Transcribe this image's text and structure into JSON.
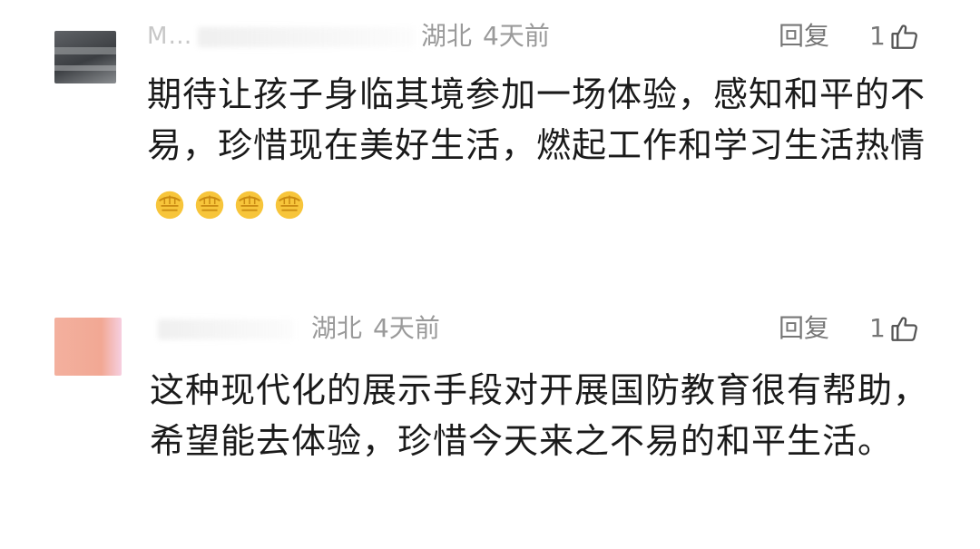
{
  "comments": [
    {
      "username": "M…",
      "location": "湖北",
      "time": "4天前",
      "reply_label": "回复",
      "like_count": "1",
      "text": "期待让孩子身临其境参加一场体验，感知和平的不易，珍惜现在美好生活，燃起工作和学习生活热情",
      "emoji": [
        "fist-emoji",
        "fist-emoji",
        "fist-emoji",
        "fist-emoji"
      ]
    },
    {
      "username": "",
      "location": "湖北",
      "time": "4天前",
      "reply_label": "回复",
      "like_count": "1",
      "text": "这种现代化的展示手段对开展国防教育很有帮助，希望能去体验，珍惜今天来之不易的和平生活。"
    }
  ],
  "colors": {
    "meta_text": "#9a9a9a",
    "body_text": "#1a1a1a",
    "action_text": "#777777",
    "emoji_fill": "#f7c53b"
  },
  "icons": [
    "thumbs-up-icon",
    "fist-emoji"
  ]
}
